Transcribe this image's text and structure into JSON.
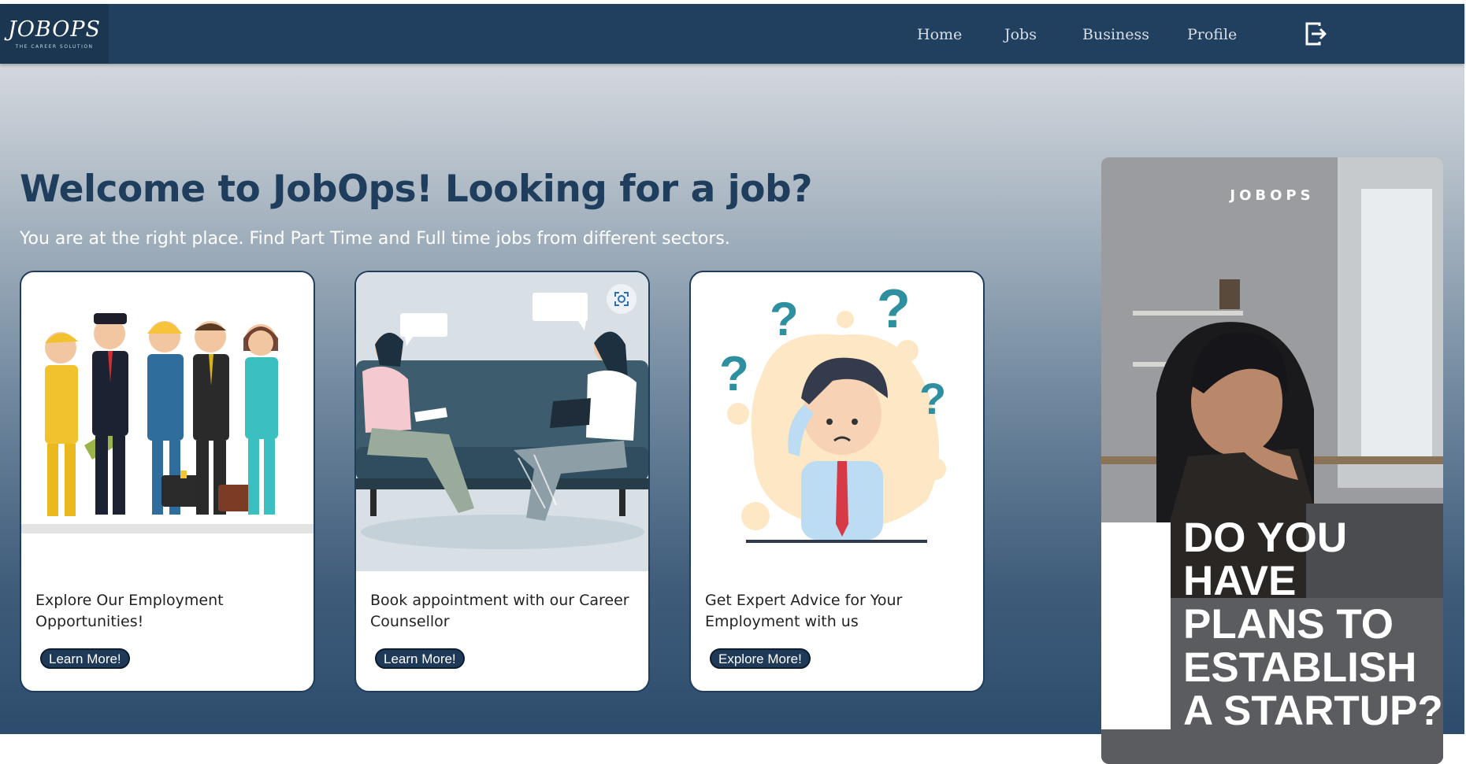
{
  "brand": {
    "logo_text": "JOBOPS",
    "logo_tagline": "THE CAREER SOLUTION"
  },
  "nav": {
    "items": [
      {
        "label": "Home"
      },
      {
        "label": "Jobs"
      },
      {
        "label": "Business"
      },
      {
        "label": "Profile"
      }
    ],
    "logout_icon": "logout-icon"
  },
  "hero": {
    "title": "Welcome to JobOps! Looking for a job?",
    "subtitle": "You are at the right place. Find Part Time and Full time jobs from different sectors."
  },
  "cards": [
    {
      "text": "Explore Our Employment Opportunities!",
      "button": "Learn More!",
      "image": "workers-illustration"
    },
    {
      "text": "Book appointment with our Career Counsellor",
      "button": "Learn More!",
      "image": "counselling-illustration"
    },
    {
      "text": "Get Expert Advice for Your Employment with us",
      "button": "Explore More!",
      "image": "confused-person-illustration"
    }
  ],
  "ad": {
    "brand": "JOBOPS",
    "headline": "DO YOU HAVE PLANS TO ESTABLISH A STARTUP?"
  },
  "colors": {
    "navbar": "#21405f",
    "title": "#1f3d5c",
    "button": "#1e3a58"
  }
}
